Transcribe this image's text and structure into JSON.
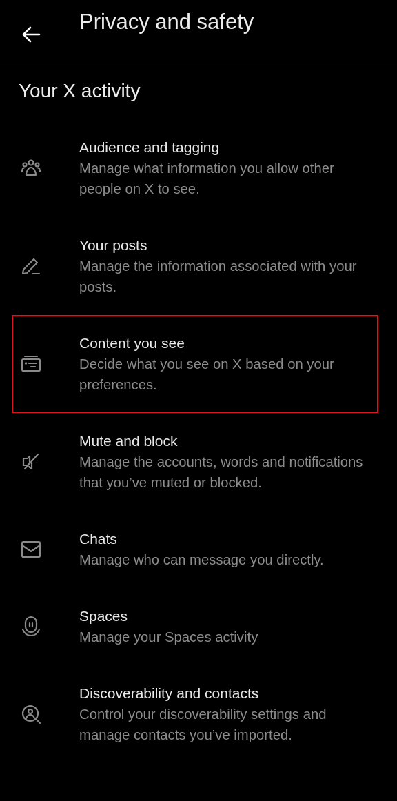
{
  "header": {
    "title": "Privacy and safety"
  },
  "section": {
    "title": "Your X activity"
  },
  "items": [
    {
      "title": "Audience and tagging",
      "description": "Manage what information you allow other people on X to see.",
      "highlighted": false
    },
    {
      "title": "Your posts",
      "description": "Manage the information associated with your posts.",
      "highlighted": false
    },
    {
      "title": "Content you see",
      "description": "Decide what you see on X based on your preferences.",
      "highlighted": true
    },
    {
      "title": "Mute and block",
      "description": "Manage the accounts, words and notifications that you’ve muted or blocked.",
      "highlighted": false
    },
    {
      "title": "Chats",
      "description": "Manage who can message you directly.",
      "highlighted": false
    },
    {
      "title": "Spaces",
      "description": "Manage your Spaces activity",
      "highlighted": false
    },
    {
      "title": "Discoverability and contacts",
      "description": "Control your discoverability settings and manage contacts you’ve imported.",
      "highlighted": false
    }
  ]
}
